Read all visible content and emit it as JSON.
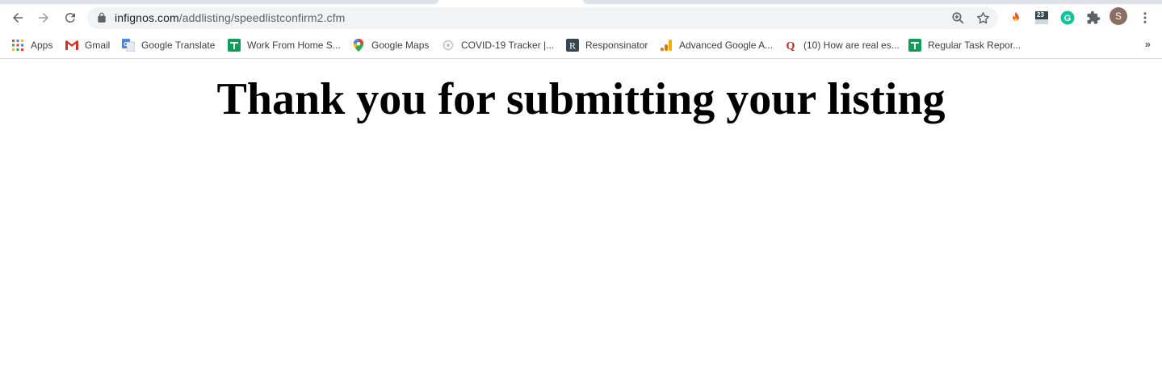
{
  "browser": {
    "url_host": "infignos.com",
    "url_path": "/addlisting/speedlistconfirm2.cfm",
    "avatar_initial": "S",
    "calendar_badge": "23"
  },
  "bookmarks": [
    {
      "label": "Apps",
      "icon": "apps-grid-icon"
    },
    {
      "label": "Gmail",
      "icon": "gmail-icon"
    },
    {
      "label": "Google Translate",
      "icon": "translate-icon"
    },
    {
      "label": "Work From Home S...",
      "icon": "sheets-icon"
    },
    {
      "label": "Google Maps",
      "icon": "maps-pin-icon"
    },
    {
      "label": "COVID-19 Tracker |...",
      "icon": "globe-icon"
    },
    {
      "label": "Responsinator",
      "icon": "responsinator-icon"
    },
    {
      "label": "Advanced Google A...",
      "icon": "analytics-icon"
    },
    {
      "label": "(10) How are real es...",
      "icon": "quora-icon"
    },
    {
      "label": "Regular Task Repor...",
      "icon": "sheets-icon"
    }
  ],
  "page": {
    "heading": "Thank you for submitting your listing"
  },
  "colors": {
    "toolbar_bg": "#ffffff",
    "omnibox_bg": "#f1f3f4",
    "text": "#202124",
    "sheets_green": "#0f9d58",
    "grammarly_green": "#15c39a"
  }
}
